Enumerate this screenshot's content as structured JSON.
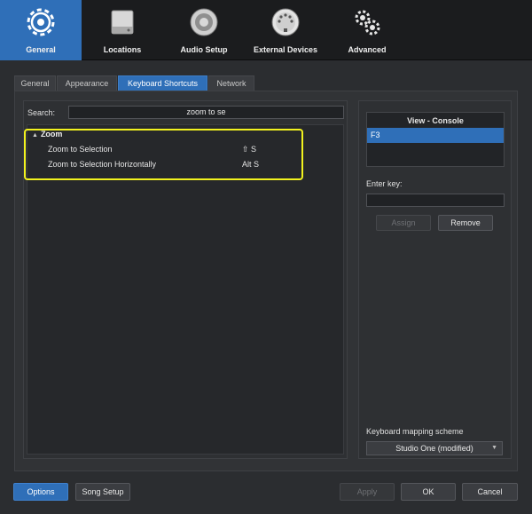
{
  "toolbar": {
    "items": [
      {
        "label": "General",
        "icon": "gear-icon",
        "active": true
      },
      {
        "label": "Locations",
        "icon": "drive-icon",
        "active": false
      },
      {
        "label": "Audio Setup",
        "icon": "speaker-icon",
        "active": false
      },
      {
        "label": "External Devices",
        "icon": "midi-port-icon",
        "active": false
      },
      {
        "label": "Advanced",
        "icon": "gears-icon",
        "active": false
      }
    ]
  },
  "tabs": [
    {
      "label": "General",
      "active": false
    },
    {
      "label": "Appearance",
      "active": false
    },
    {
      "label": "Keyboard Shortcuts",
      "active": true
    },
    {
      "label": "Network",
      "active": false
    }
  ],
  "search": {
    "label": "Search:",
    "value": "zoom to se"
  },
  "tree": {
    "group": "Zoom",
    "rows": [
      {
        "name": "Zoom to Selection",
        "key": "⇧ S"
      },
      {
        "name": "Zoom to Selection Horizontally",
        "key": "Alt S"
      }
    ]
  },
  "context": {
    "title": "View - Console",
    "selected": "F3"
  },
  "enter_key": {
    "label": "Enter key:",
    "value": ""
  },
  "buttons": {
    "assign": "Assign",
    "remove": "Remove",
    "options": "Options",
    "song_setup": "Song Setup",
    "apply": "Apply",
    "ok": "OK",
    "cancel": "Cancel"
  },
  "mapping": {
    "label": "Keyboard mapping scheme",
    "value": "Studio One (modified)"
  },
  "colors": {
    "accent": "#2f6fb8",
    "highlight": "#f2f21e",
    "background": "#2b2d30"
  }
}
